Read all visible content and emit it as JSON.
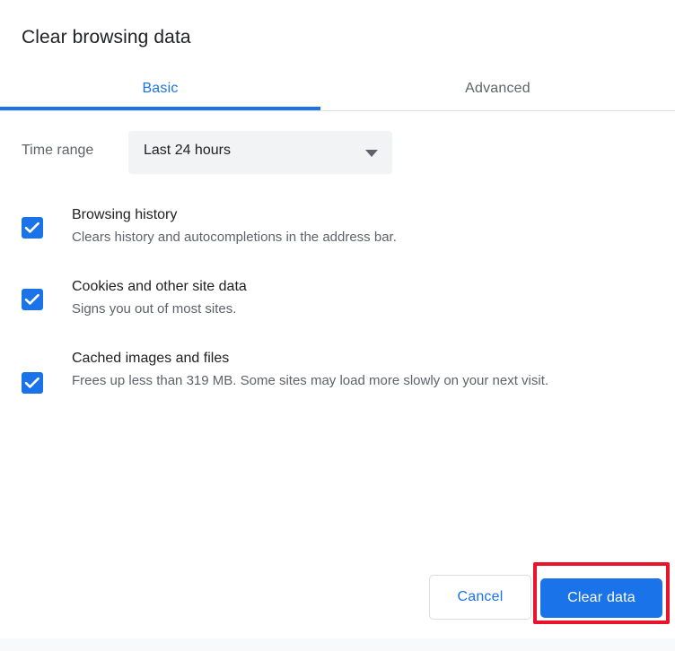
{
  "dialog": {
    "title": "Clear browsing data"
  },
  "tabs": [
    {
      "label": "Basic",
      "selected": true
    },
    {
      "label": "Advanced",
      "selected": false
    }
  ],
  "time_range": {
    "label": "Time range",
    "selected_value": "Last 24 hours",
    "icon": "chevron-down-icon"
  },
  "items": [
    {
      "title": "Browsing history",
      "description": "Clears history and autocompletions in the address bar.",
      "checked": true
    },
    {
      "title": "Cookies and other site data",
      "description": "Signs you out of most sites.",
      "checked": true
    },
    {
      "title": "Cached images and files",
      "description": "Frees up less than 319 MB. Some sites may load more slowly on your next visit.",
      "checked": true
    }
  ],
  "footer": {
    "cancel_label": "Cancel",
    "clear_label": "Clear data"
  },
  "colors": {
    "accent_blue": "#1a73e8",
    "text_primary": "#202124",
    "text_secondary": "#5f6368",
    "select_background": "#f1f3f4",
    "highlight_red": "#e8152a",
    "border_gray": "#dadce0"
  }
}
